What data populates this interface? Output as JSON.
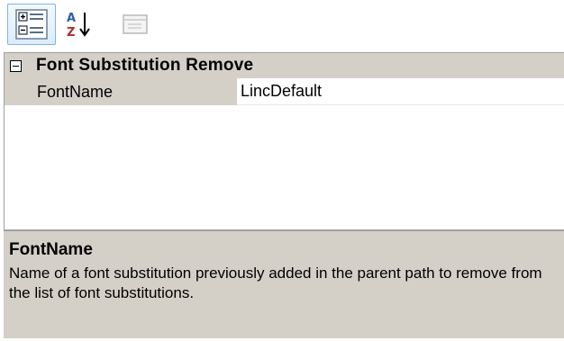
{
  "toolbar": {
    "buttons": [
      {
        "name": "categorized",
        "icon": "categorized-view-icon",
        "pressed": true
      },
      {
        "name": "alphabetical",
        "icon": "sort-alphabetical-icon",
        "pressed": false
      },
      {
        "name": "property-pages",
        "icon": "property-pages-icon",
        "disabled": true
      }
    ]
  },
  "grid": {
    "category": {
      "title": "Font Substitution Remove",
      "expanded": true
    },
    "properties": [
      {
        "name": "FontName",
        "value": "LincDefault"
      }
    ]
  },
  "help": {
    "title": "FontName",
    "description": "Name of a font substitution previously added in the parent path to remove from the list of font substitutions."
  },
  "colors": {
    "panel": "#d4d0c8",
    "border": "#a0a0a0",
    "toolbar_pressed": "#dcecfc",
    "toolbar_pressed_border": "#7eb4ea"
  }
}
